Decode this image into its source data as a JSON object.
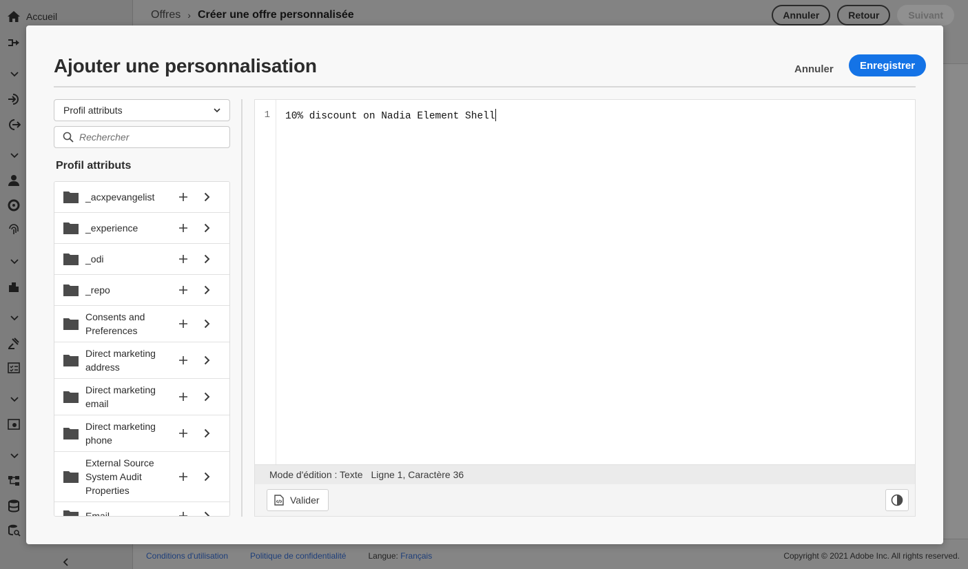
{
  "app": {
    "sidebar": {
      "home_label": "Accueil"
    },
    "breadcrumb": {
      "parent": "Offres",
      "current": "Créer une offre personnalisée"
    },
    "header_actions": {
      "cancel": "Annuler",
      "back": "Retour",
      "next": "Suivant"
    },
    "footer": {
      "terms": "Conditions d'utilisation",
      "privacy": "Politique de confidentialité",
      "language_label": "Langue:",
      "language_value": "Français",
      "copyright": "Copyright ©  2021 Adobe Inc.  All rights reserved."
    }
  },
  "modal": {
    "title": "Ajouter une personnalisation",
    "cancel_label": "Annuler",
    "save_label": "Enregistrer",
    "source_select": {
      "selected": "Profil attributs"
    },
    "search": {
      "placeholder": "Rechercher"
    },
    "section_heading": "Profil attributs",
    "tree_items": [
      {
        "label": "_acxpevangelist"
      },
      {
        "label": "_experience"
      },
      {
        "label": "_odi"
      },
      {
        "label": "_repo"
      },
      {
        "label": "Consents and Preferences"
      },
      {
        "label": "Direct marketing address"
      },
      {
        "label": "Direct marketing email"
      },
      {
        "label": "Direct marketing phone"
      },
      {
        "label": "External Source System Audit Properties"
      },
      {
        "label": "Email"
      }
    ],
    "editor": {
      "line_number": "1",
      "code": "10% discount on Nadia Element Shell",
      "mode": "Mode d'édition : Texte",
      "position": "Ligne 1, Caractère 36",
      "validate_label": "Valider"
    }
  },
  "colors": {
    "accent": "#1473e6",
    "overlay": "#8a8a8a"
  }
}
